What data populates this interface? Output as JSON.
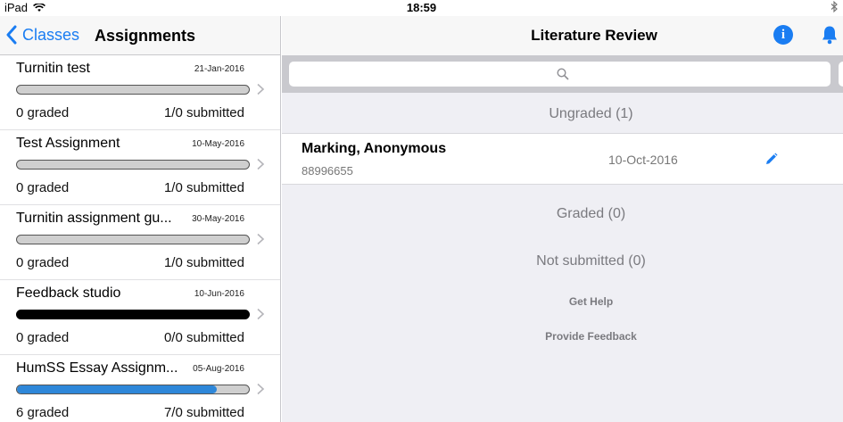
{
  "status_bar": {
    "device": "iPad",
    "time": "18:59",
    "bluetooth": "bluetooth-icon"
  },
  "left_nav": {
    "back_label": "Classes",
    "title": "Assignments"
  },
  "assignments": [
    {
      "name": "Turnitin test",
      "date": "21-Jan-2016",
      "graded": "0 graded",
      "submitted": "1/0 submitted",
      "progress": 0,
      "bar_color": "#cfcfcf"
    },
    {
      "name": "Test Assignment",
      "date": "10-May-2016",
      "graded": "0 graded",
      "submitted": "1/0 submitted",
      "progress": 0,
      "bar_color": "#cfcfcf"
    },
    {
      "name": "Turnitin assignment gu...",
      "date": "30-May-2016",
      "graded": "0 graded",
      "submitted": "1/0 submitted",
      "progress": 0,
      "bar_color": "#cfcfcf"
    },
    {
      "name": "Feedback studio",
      "date": "10-Jun-2016",
      "graded": "0 graded",
      "submitted": "0/0 submitted",
      "progress": 1,
      "bar_color": "#000000"
    },
    {
      "name": "HumSS Essay Assignm...",
      "date": "05-Aug-2016",
      "graded": "6 graded",
      "submitted": "7/0 submitted",
      "progress": 0.86,
      "bar_color": "#2e87d9"
    }
  ],
  "right_nav": {
    "title": "Literature Review",
    "info_icon": "info-icon",
    "bell_icon": "bell-icon"
  },
  "search": {
    "placeholder": "",
    "value": ""
  },
  "sections": {
    "ungraded": "Ungraded (1)",
    "graded": "Graded (0)",
    "not_submitted": "Not submitted (0)"
  },
  "submission": {
    "name": "Marking, Anonymous",
    "id": "88996655",
    "date": "10-Oct-2016"
  },
  "links": {
    "get_help": "Get Help",
    "provide_feedback": "Provide Feedback"
  },
  "colors": {
    "accent": "#1a7df2",
    "progress_blue": "#2e87d9"
  }
}
